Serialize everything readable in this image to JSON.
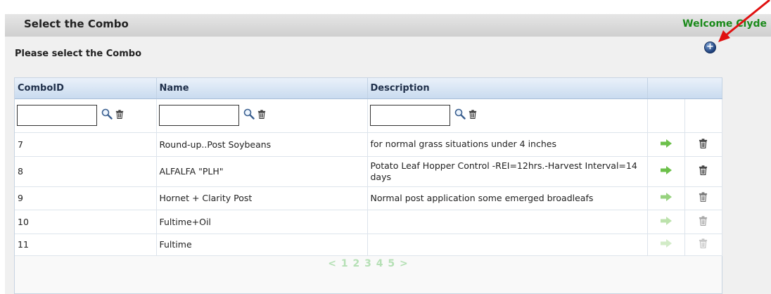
{
  "header": {
    "title": "Select the Combo",
    "welcome": "Welcome Clyde"
  },
  "subtitle": "Please select the Combo",
  "table": {
    "columns": [
      "ComboID",
      "Name",
      "Description"
    ],
    "rows": [
      {
        "id": "7",
        "name": "Round-up..Post Soybeans",
        "description": "for normal grass situations under 4 inches"
      },
      {
        "id": "8",
        "name": "ALFALFA \"PLH\"",
        "description": "Potato Leaf Hopper Control -REI=12hrs.-Harvest Interval=14 days"
      },
      {
        "id": "9",
        "name": "Hornet + Clarity Post",
        "description": "Normal post application some emerged broadleafs"
      },
      {
        "id": "10",
        "name": "Fultime+Oil",
        "description": ""
      },
      {
        "id": "11",
        "name": "Fultime",
        "description": ""
      }
    ]
  },
  "pager": "< 1 2 3 4 5 >",
  "colors": {
    "welcome": "#1a8a1a",
    "action_arrow": "#6cc04a",
    "annotation_arrow": "#e01010"
  },
  "icons": [
    "search-icon",
    "trash-icon",
    "arrow-right-icon",
    "add-circle-icon"
  ]
}
